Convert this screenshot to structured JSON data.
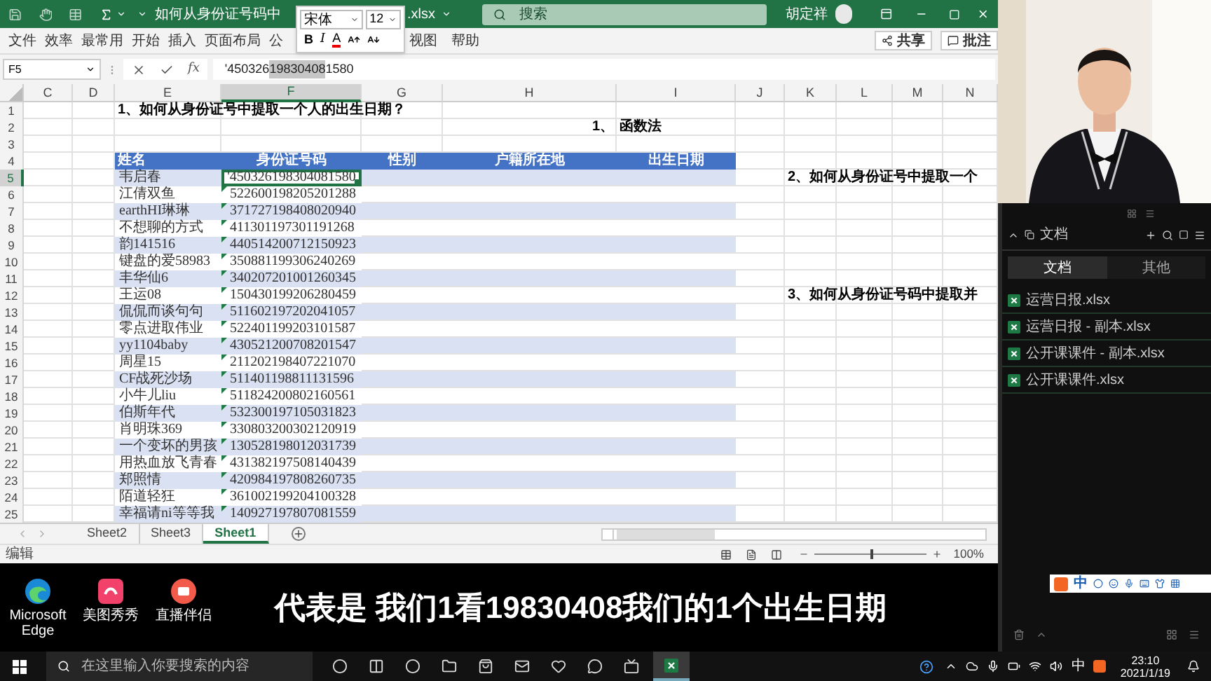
{
  "excel": {
    "title_bar": {
      "title_start": "如何从身份证号码中",
      "title_end": ".xlsx",
      "search": {
        "placeholder": "搜索"
      },
      "user": "胡定祥"
    },
    "mini_toolbar": {
      "font": "宋体",
      "size": "12",
      "bold": "B",
      "italic": "I",
      "font_color": "A"
    },
    "ribbon": {
      "tabs": [
        "文件",
        "效率",
        "最常用",
        "开始",
        "插入",
        "页面布局",
        "公"
      ],
      "tabs_after_toolbar": [
        "视图",
        "帮助"
      ],
      "share": "共享",
      "comments": "批注"
    },
    "formula_bar": {
      "name_box": "F5",
      "function_label": "fx",
      "value_parts": [
        {
          "text": "'450326",
          "selected": false
        },
        {
          "text": "19830408",
          "selected": true
        },
        {
          "text": "1580",
          "selected": false
        }
      ]
    },
    "sheet": {
      "columns": [
        {
          "label": "C",
          "selected": false
        },
        {
          "label": "D",
          "selected": false
        },
        {
          "label": "E",
          "selected": false
        },
        {
          "label": "F",
          "selected": true
        },
        {
          "label": "G",
          "selected": false
        },
        {
          "label": "H",
          "selected": false
        },
        {
          "label": "I",
          "selected": false
        },
        {
          "label": "J",
          "selected": false
        },
        {
          "label": "K",
          "selected": false
        },
        {
          "label": "L",
          "selected": false
        },
        {
          "label": "M",
          "selected": false
        },
        {
          "label": "N",
          "selected": false
        }
      ],
      "rows": [
        {
          "number": "1",
          "kind": "title",
          "selected": false,
          "E": "1、如何从身份证号中提取一个人的出生日期？"
        },
        {
          "number": "2",
          "kind": "subtitle",
          "selected": false,
          "H": "1、",
          "I": "函数法"
        },
        {
          "number": "3",
          "kind": "title",
          "selected": false
        },
        {
          "number": "4",
          "kind": "table_header",
          "selected": false,
          "E": "姓名",
          "F": "身份证号码",
          "G": "性别",
          "H": "户籍所在地",
          "I": "出生日期"
        },
        {
          "number": "5",
          "kind": "table_row",
          "banded": true,
          "selected": true,
          "E": "韦启春",
          "F": "'450326198304081580",
          "K": "2、如何从身份证号中提取一个"
        },
        {
          "number": "6",
          "kind": "table_row",
          "banded": false,
          "selected": false,
          "E": "江倩双鱼",
          "F": "522600198205201288"
        },
        {
          "number": "7",
          "kind": "table_row",
          "banded": true,
          "selected": false,
          "E": "earthHI琳琳",
          "F": "371727198408020940"
        },
        {
          "number": "8",
          "kind": "table_row",
          "banded": false,
          "selected": false,
          "E": "不想聊的方式",
          "F": "411301197301191268"
        },
        {
          "number": "9",
          "kind": "table_row",
          "banded": true,
          "selected": false,
          "E": "韵141516",
          "F": "440514200712150923"
        },
        {
          "number": "10",
          "kind": "table_row",
          "banded": false,
          "selected": false,
          "E": "键盘的爱58983",
          "F": "350881199306240269"
        },
        {
          "number": "11",
          "kind": "table_row",
          "banded": true,
          "selected": false,
          "E": "丰华仙6",
          "F": "340207201001260345"
        },
        {
          "number": "12",
          "kind": "table_row",
          "banded": false,
          "selected": false,
          "E": "王运08",
          "F": "150430199206280459",
          "K": "3、如何从身份证号码中提取并"
        },
        {
          "number": "13",
          "kind": "table_row",
          "banded": true,
          "selected": false,
          "E": "侃侃而谈句句",
          "F": "511602197202041057"
        },
        {
          "number": "14",
          "kind": "table_row",
          "banded": false,
          "selected": false,
          "E": "零点进取伟业",
          "F": "522401199203101587"
        },
        {
          "number": "15",
          "kind": "table_row",
          "banded": true,
          "selected": false,
          "E": "yy1104baby",
          "F": "430521200708201547"
        },
        {
          "number": "16",
          "kind": "table_row",
          "banded": false,
          "selected": false,
          "E": "周星15",
          "F": "211202198407221070"
        },
        {
          "number": "17",
          "kind": "table_row",
          "banded": true,
          "selected": false,
          "E": "CF战死沙场",
          "F": "511401198811131596"
        },
        {
          "number": "18",
          "kind": "table_row",
          "banded": false,
          "selected": false,
          "E": "小牛儿liu",
          "F": "511824200802160561"
        },
        {
          "number": "19",
          "kind": "table_row",
          "banded": true,
          "selected": false,
          "E": "伯斯年代",
          "F": "532300197105031823"
        },
        {
          "number": "20",
          "kind": "table_row",
          "banded": false,
          "selected": false,
          "E": "肖明珠369",
          "F": "330803200302120919"
        },
        {
          "number": "21",
          "kind": "table_row",
          "banded": true,
          "selected": false,
          "E": "一个变坏的男孩",
          "F": "130528198012031739"
        },
        {
          "number": "22",
          "kind": "table_row",
          "banded": false,
          "selected": false,
          "E": "用热血放飞青春",
          "F": "431382197508140439"
        },
        {
          "number": "23",
          "kind": "table_row",
          "banded": true,
          "selected": false,
          "E": "郑照情",
          "F": "420984197808260735"
        },
        {
          "number": "24",
          "kind": "table_row",
          "banded": false,
          "selected": false,
          "E": "陌道轻狂",
          "F": "361002199204100328"
        },
        {
          "number": "25",
          "kind": "table_row",
          "banded": true,
          "selected": false,
          "E": "幸福请ni等等我",
          "F": "140927197807081559"
        }
      ]
    },
    "sheet_tabs": [
      {
        "label": "Sheet2",
        "selected": false
      },
      {
        "label": "Sheet3",
        "selected": false
      },
      {
        "label": "Sheet1",
        "selected": true
      }
    ],
    "status_bar": {
      "mode": "编辑",
      "zoom": "100%",
      "zoom_slider": {
        "level": 0.5
      }
    }
  },
  "desktop": {
    "icons": [
      {
        "label": "Microsoft Edge",
        "kind": "edge"
      },
      {
        "label": "美图秀秀",
        "kind": "meitu"
      },
      {
        "label": "直播伴侣",
        "kind": "live"
      }
    ]
  },
  "subtitle": "代表是 我们1看19830408我们的1个出生日期",
  "file_panel": {
    "title": "文档",
    "tabs": [
      {
        "label": "文档",
        "selected": true
      },
      {
        "label": "其他",
        "selected": false
      }
    ],
    "files": [
      "运营日报.xlsx",
      "运营日报 - 副本.xlsx",
      "公开课课件 - 副本.xlsx",
      "公开课课件.xlsx"
    ]
  },
  "ime_bar": {
    "mode": "中"
  },
  "taskbar": {
    "search": {
      "placeholder": "在这里输入你要搜索的内容"
    },
    "ime": "中",
    "time": "23:10",
    "date": "2021/1/19"
  }
}
